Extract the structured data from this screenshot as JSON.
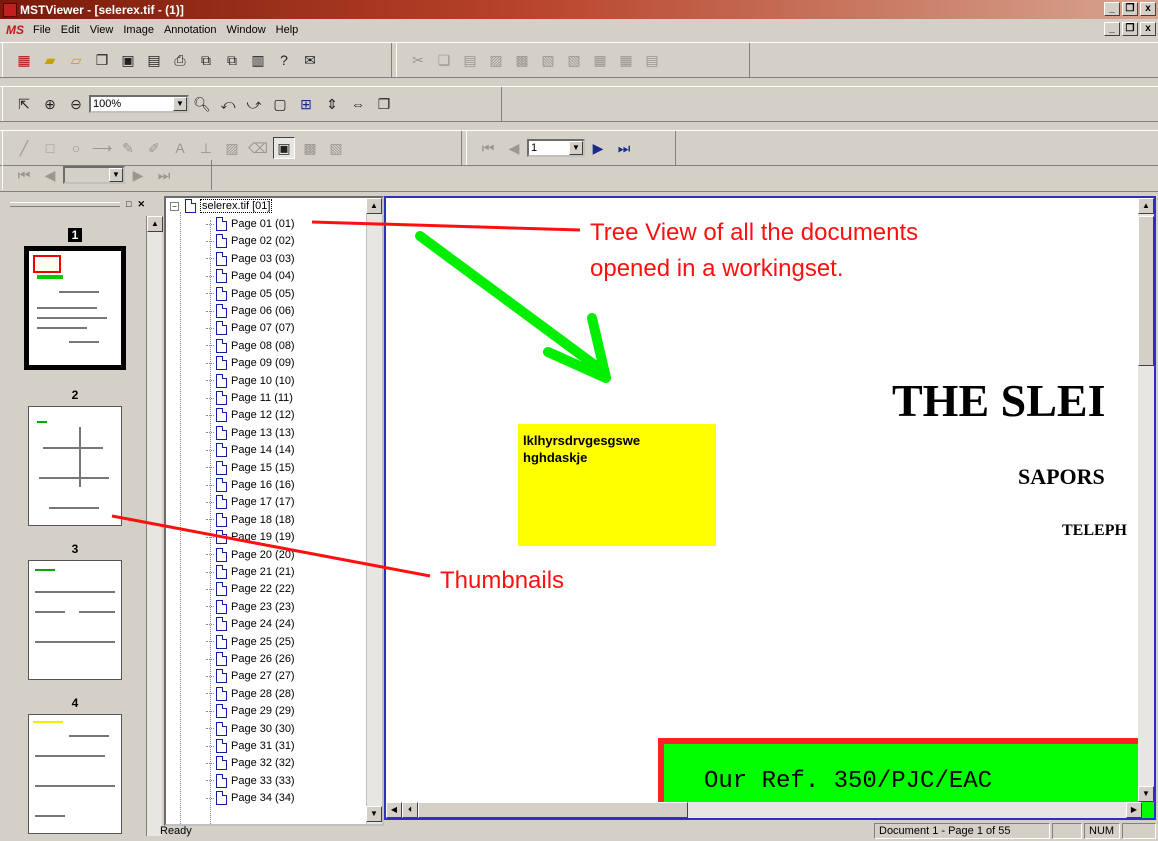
{
  "window": {
    "title": "MSTViewer - [selerex.tif - (1)]",
    "controls": [
      "_",
      "❐",
      "x"
    ]
  },
  "menu": {
    "items": [
      "File",
      "Edit",
      "View",
      "Image",
      "Annotation",
      "Window",
      "Help"
    ]
  },
  "toolbar": {
    "zoom_value": "100%",
    "page_value": "1"
  },
  "tree": {
    "root": "selerex.tif [01]",
    "pages": [
      "Page 01 (01)",
      "Page 02 (02)",
      "Page 03 (03)",
      "Page 04 (04)",
      "Page 05 (05)",
      "Page 06 (06)",
      "Page 07 (07)",
      "Page 08 (08)",
      "Page 09 (09)",
      "Page 10 (10)",
      "Page 11 (11)",
      "Page 12 (12)",
      "Page 13 (13)",
      "Page 14 (14)",
      "Page 15 (15)",
      "Page 16 (16)",
      "Page 17 (17)",
      "Page 18 (18)",
      "Page 19 (19)",
      "Page 20 (20)",
      "Page 21 (21)",
      "Page 22 (22)",
      "Page 23 (23)",
      "Page 24 (24)",
      "Page 25 (25)",
      "Page 26 (26)",
      "Page 27 (27)",
      "Page 28 (28)",
      "Page 29 (29)",
      "Page 30 (30)",
      "Page 31 (31)",
      "Page 32 (32)",
      "Page 33 (33)",
      "Page 34 (34)"
    ]
  },
  "thumbnails": {
    "numbers": [
      "1",
      "2",
      "3",
      "4"
    ],
    "selected": "1"
  },
  "document": {
    "note_line1": "lklhyrsdrvgesgswe",
    "note_line2": "hghdaskje",
    "heading": "THE SLEI",
    "sub1": "SAPORS",
    "sub2": "TELEPH",
    "ref": "Our Ref. 350/PJC/EAC"
  },
  "annotations": {
    "tree_callout_line1": "Tree View of all the documents",
    "tree_callout_line2": "opened in a workingset.",
    "thumb_callout": "Thumbnails",
    "colors": {
      "callout": "#ff1010",
      "arrow": "#00ee00",
      "note": "#ffff00"
    }
  },
  "status": {
    "ready": "Ready",
    "page_info": "Document 1 - Page 1 of 55",
    "num": "NUM"
  }
}
